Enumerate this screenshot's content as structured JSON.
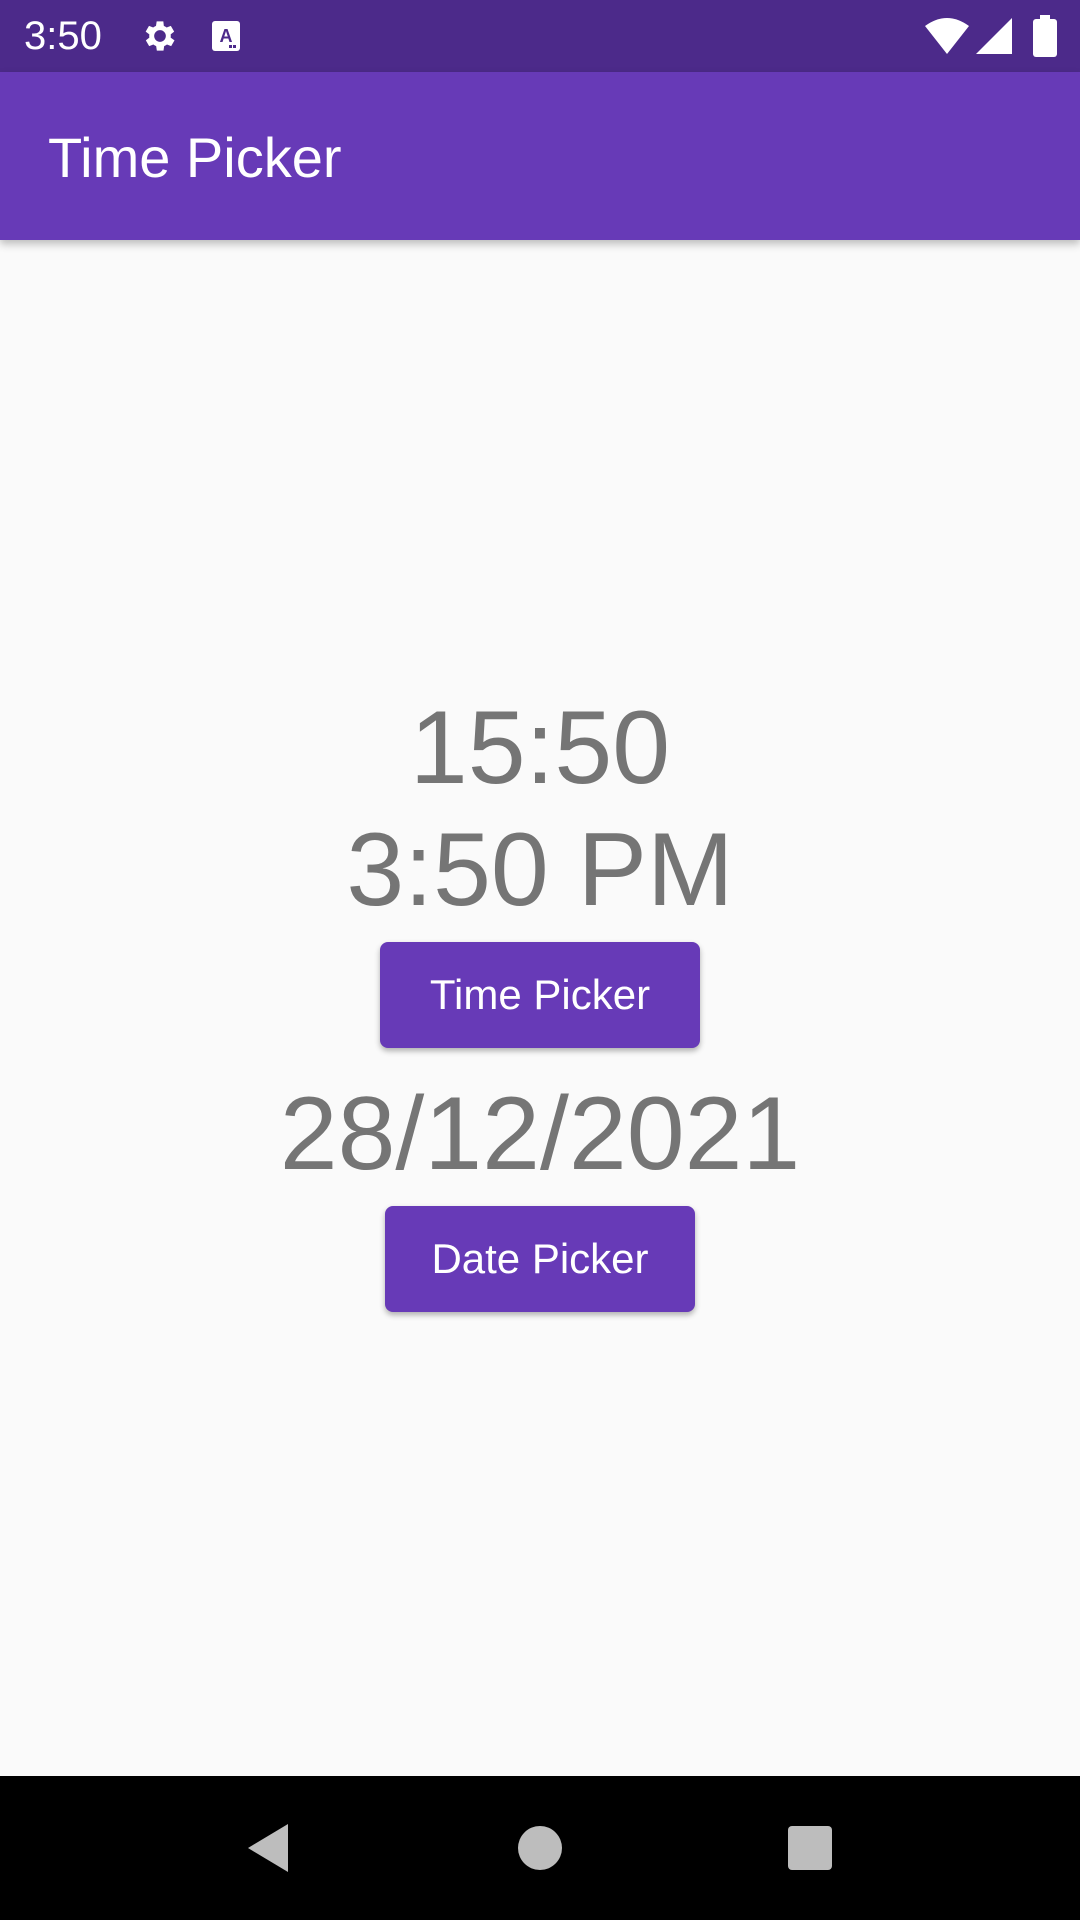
{
  "status_bar": {
    "time": "3:50",
    "icons": [
      "settings-icon",
      "keyboard-a-icon",
      "wifi-icon",
      "signal-icon",
      "battery-icon"
    ]
  },
  "app_bar": {
    "title": "Time Picker"
  },
  "main": {
    "time_24h": "15:50",
    "time_12h": "3:50 PM",
    "time_picker_label": "Time Picker",
    "date": "28/12/2021",
    "date_picker_label": "Date Picker"
  },
  "nav_bar": {
    "icons": [
      "back-icon",
      "home-icon",
      "recents-icon"
    ]
  },
  "colors": {
    "primary": "#673ab7",
    "primary_dark": "#4c2a8a",
    "text_gray": "#757575",
    "background": "#fafafa"
  }
}
